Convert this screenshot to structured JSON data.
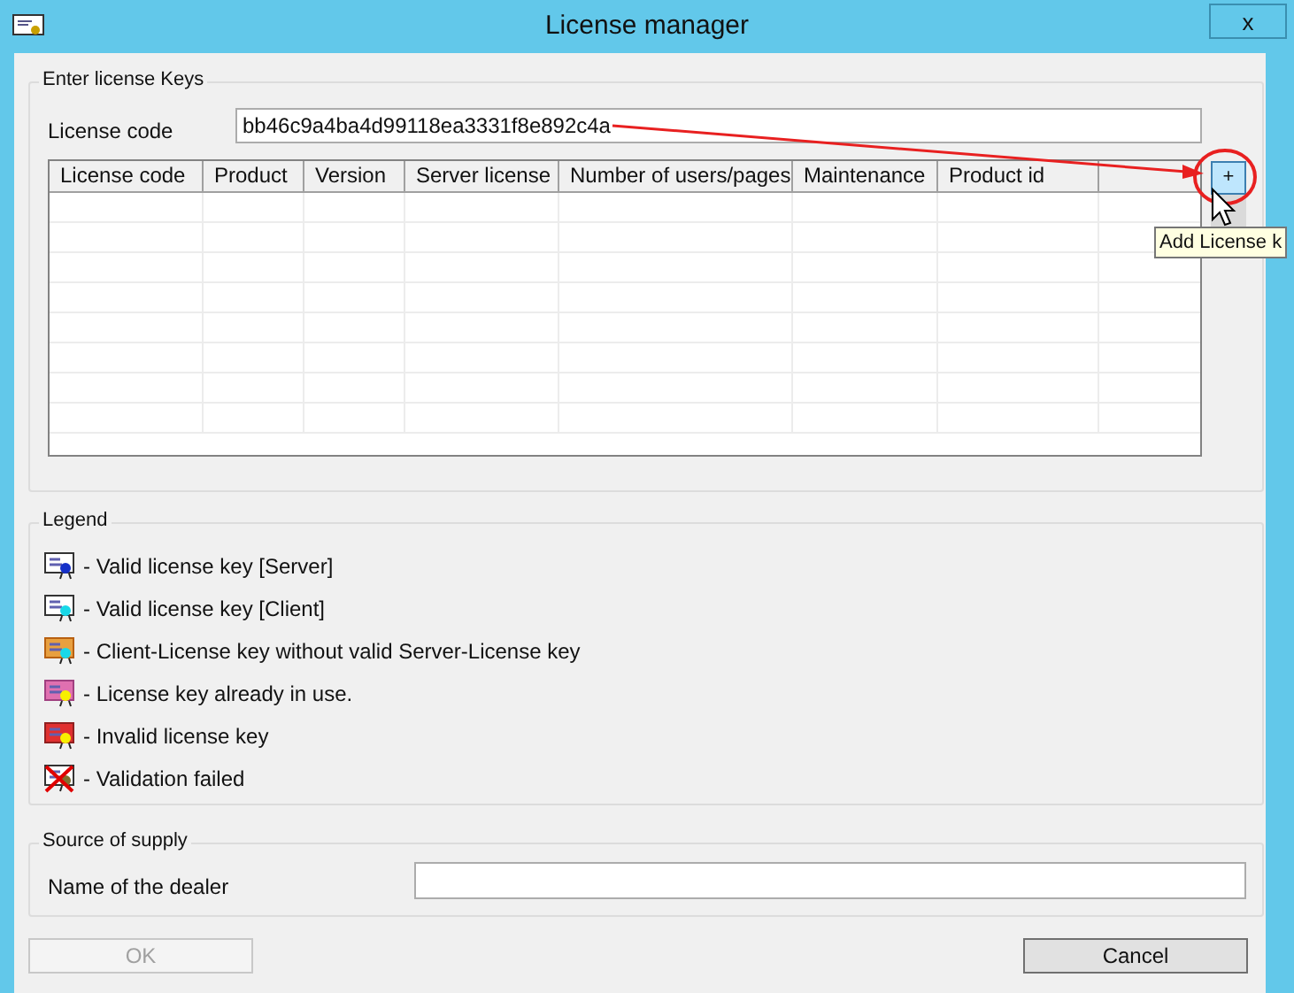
{
  "window": {
    "title": "License manager",
    "close": "x"
  },
  "entry": {
    "group_title": "Enter license Keys",
    "label": "License code",
    "value": "bb46c9a4ba4d99118ea3331f8e892c4a",
    "table": {
      "columns": [
        "License code",
        "Product",
        "Version",
        "Server license",
        "Number of users/pages",
        "Maintenance",
        "Product id"
      ]
    },
    "add_button": "+",
    "tooltip": "Add License k"
  },
  "legend": {
    "title": "Legend",
    "items": [
      {
        "kind": "server",
        "text": "- Valid license key [Server]"
      },
      {
        "kind": "client",
        "text": "- Valid license key [Client]"
      },
      {
        "kind": "client-no-server",
        "text": "- Client-License key without valid Server-License key"
      },
      {
        "kind": "in-use",
        "text": "- License key already in use."
      },
      {
        "kind": "invalid",
        "text": "- Invalid license key"
      },
      {
        "kind": "failed",
        "text": "- Validation failed"
      }
    ]
  },
  "supply": {
    "title": "Source of supply",
    "label": "Name of the dealer"
  },
  "buttons": [
    {
      "label": "OK",
      "disabled": true
    },
    {
      "label": "Cancel",
      "disabled": false
    }
  ]
}
